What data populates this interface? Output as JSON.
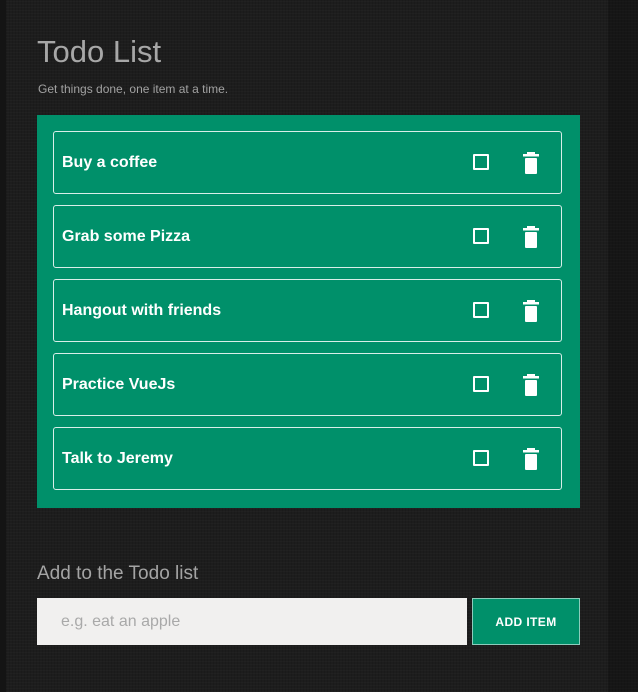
{
  "header": {
    "title": "Todo List",
    "subtitle": "Get things done, one item at a time."
  },
  "todos": [
    {
      "label": "Buy a coffee",
      "checked": false
    },
    {
      "label": "Grab some Pizza",
      "checked": false
    },
    {
      "label": "Hangout with friends",
      "checked": false
    },
    {
      "label": "Practice VueJs",
      "checked": false
    },
    {
      "label": "Talk to Jeremy",
      "checked": false
    }
  ],
  "add_form": {
    "heading": "Add to the Todo list",
    "input_value": "",
    "input_placeholder": "e.g. eat an apple",
    "button_label": "ADD ITEM"
  },
  "icons": {
    "checkbox": "checkbox-icon",
    "delete": "trash-icon"
  },
  "colors": {
    "background": "#1d1d1d",
    "accent": "#00906a",
    "item_text": "#ffffff",
    "heading_text": "#a7a7a7",
    "input_background": "#f1f0ef"
  }
}
